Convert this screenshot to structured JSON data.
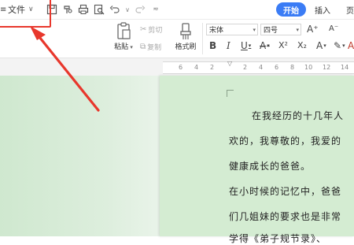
{
  "menu": {
    "file_label": "文件"
  },
  "quick_access": {
    "icons": [
      "save-icon",
      "format-painter-icon",
      "print-icon",
      "print-preview-icon",
      "undo-icon",
      "redo-icon",
      "customize-icon"
    ]
  },
  "tabs": {
    "start": "开始",
    "insert": "插入",
    "page_partial": "页"
  },
  "ribbon": {
    "paste": "粘贴",
    "cut": "剪切",
    "copy": "复制",
    "format_painter": "格式刷",
    "font_name": "宋体",
    "font_size": "四号",
    "font_buttons": [
      "B",
      "I",
      "U",
      "A",
      "X²",
      "X₂",
      "A",
      "A"
    ],
    "grow_font": "A⁺",
    "shrink_font": "A⁻"
  },
  "ruler": {
    "ticks": [
      "6",
      "4",
      "2",
      "2",
      "4",
      "6",
      "8",
      "10",
      "12",
      "14"
    ]
  },
  "document": {
    "lines": [
      "在我经历的十几年人",
      "欢的，我尊敬的，我爱的",
      "健康成长的爸爸。",
      "在小时候的记忆中，爸爸",
      "们几姐妹的要求也是非常",
      "学得《弟子规节录》、"
    ]
  },
  "colors": {
    "accent": "#3b7cf5",
    "annotation": "#e8372c",
    "page_background": "#d4ecd2"
  }
}
